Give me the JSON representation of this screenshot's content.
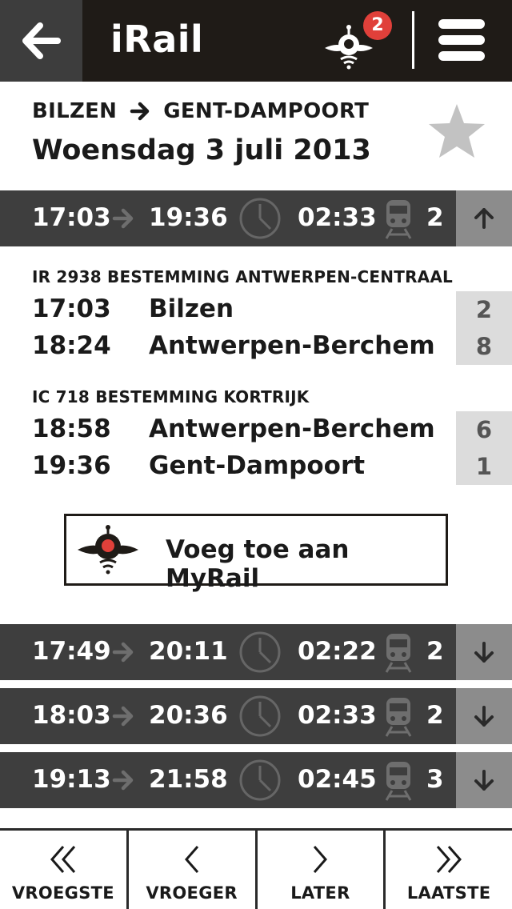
{
  "header": {
    "title": "iRail",
    "notification_count": "2",
    "back_icon": "arrow-left-icon",
    "menu_icon": "hamburger-menu-icon"
  },
  "route": {
    "from": "BILZEN",
    "to": "GENT-DAMPOORT",
    "date": "Woensdag 3 juli 2013",
    "favorite_icon": "star-icon"
  },
  "trips": [
    {
      "dep": "17:03",
      "arr": "19:36",
      "duration": "02:33",
      "changes": "2",
      "expanded": true
    },
    {
      "dep": "17:49",
      "arr": "20:11",
      "duration": "02:22",
      "changes": "2",
      "expanded": false
    },
    {
      "dep": "18:03",
      "arr": "20:36",
      "duration": "02:33",
      "changes": "2",
      "expanded": false
    },
    {
      "dep": "19:13",
      "arr": "21:58",
      "duration": "02:45",
      "changes": "3",
      "expanded": false
    }
  ],
  "detail": {
    "legs": [
      {
        "title": "IR 2938 BESTEMMING ANTWERPEN-CENTRAAL",
        "stops": [
          {
            "time": "17:03",
            "station": "Bilzen",
            "platform": "2"
          },
          {
            "time": "18:24",
            "station": "Antwerpen-Berchem",
            "platform": "8"
          }
        ]
      },
      {
        "title": "IC 718 BESTEMMING KORTRIJK",
        "stops": [
          {
            "time": "18:58",
            "station": "Antwerpen-Berchem",
            "platform": "6"
          },
          {
            "time": "19:36",
            "station": "Gent-Dampoort",
            "platform": "1"
          }
        ]
      }
    ],
    "add_button_label": "Voeg toe aan MyRail"
  },
  "bottom_nav": [
    {
      "label": "VROEGSTE",
      "icon": "double-chevron-left-icon"
    },
    {
      "label": "VROEGER",
      "icon": "chevron-left-icon"
    },
    {
      "label": "LATER",
      "icon": "chevron-right-icon"
    },
    {
      "label": "LAATSTE",
      "icon": "double-chevron-right-icon"
    }
  ],
  "colors": {
    "header_bg": "#1f1b17",
    "trip_bg": "#3e3e3e",
    "toggle_bg": "#8c8c8c",
    "platform_bg": "#dcdcdc",
    "badge": "#e0403a"
  }
}
